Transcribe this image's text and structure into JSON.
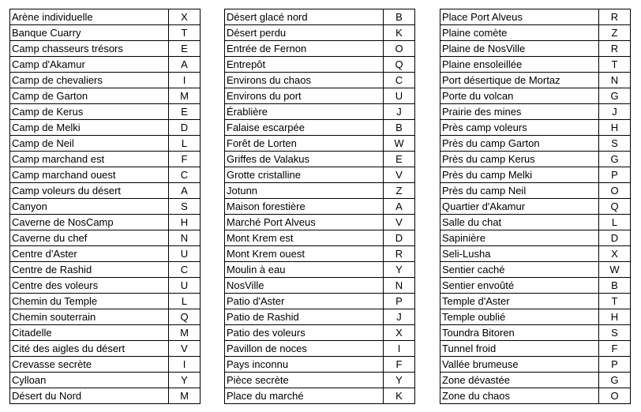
{
  "tables": [
    {
      "rows": [
        {
          "name": "Arène individuelle",
          "code": "X"
        },
        {
          "name": "Banque Cuarry",
          "code": "T"
        },
        {
          "name": "Camp chasseurs trésors",
          "code": "E"
        },
        {
          "name": "Camp d'Akamur",
          "code": "A"
        },
        {
          "name": "Camp de chevaliers",
          "code": "I"
        },
        {
          "name": "Camp de Garton",
          "code": "M"
        },
        {
          "name": "Camp de Kerus",
          "code": "E"
        },
        {
          "name": "Camp de Melki",
          "code": "D"
        },
        {
          "name": "Camp de Neil",
          "code": "L"
        },
        {
          "name": "Camp marchand est",
          "code": "F"
        },
        {
          "name": "Camp marchand ouest",
          "code": "C"
        },
        {
          "name": "Camp voleurs du désert",
          "code": "A"
        },
        {
          "name": "Canyon",
          "code": "S"
        },
        {
          "name": "Caverne de NosCamp",
          "code": "H"
        },
        {
          "name": "Caverne du chef",
          "code": "N"
        },
        {
          "name": "Centre d'Aster",
          "code": "U"
        },
        {
          "name": "Centre de Rashid",
          "code": "C"
        },
        {
          "name": "Centre des voleurs",
          "code": "U"
        },
        {
          "name": "Chemin du Temple",
          "code": "L"
        },
        {
          "name": "Chemin souterrain",
          "code": "Q"
        },
        {
          "name": "Citadelle",
          "code": "M"
        },
        {
          "name": "Cité des aigles du désert",
          "code": "V"
        },
        {
          "name": "Crevasse secrète",
          "code": "I"
        },
        {
          "name": "Cylloan",
          "code": "Y"
        },
        {
          "name": "Désert du Nord",
          "code": "M"
        }
      ]
    },
    {
      "rows": [
        {
          "name": "Désert glacé nord",
          "code": "B"
        },
        {
          "name": "Désert perdu",
          "code": "K"
        },
        {
          "name": "Entrée de Fernon",
          "code": "O"
        },
        {
          "name": "Entrepôt",
          "code": "Q"
        },
        {
          "name": "Environs du chaos",
          "code": "C"
        },
        {
          "name": "Environs du port",
          "code": "U"
        },
        {
          "name": "Érablière",
          "code": "J"
        },
        {
          "name": "Falaise escarpée",
          "code": "B"
        },
        {
          "name": "Forêt de Lorten",
          "code": "W"
        },
        {
          "name": "Griffes de Valakus",
          "code": "E"
        },
        {
          "name": "Grotte cristalline",
          "code": "V"
        },
        {
          "name": "Jotunn",
          "code": "Z"
        },
        {
          "name": "Maison forestière",
          "code": "A"
        },
        {
          "name": "Marché Port Alveus",
          "code": "V"
        },
        {
          "name": "Mont Krem est",
          "code": "D"
        },
        {
          "name": "Mont Krem ouest",
          "code": "R"
        },
        {
          "name": "Moulin à eau",
          "code": "Y"
        },
        {
          "name": "NosVille",
          "code": "N"
        },
        {
          "name": "Patio d'Aster",
          "code": "P"
        },
        {
          "name": "Patio de Rashid",
          "code": "J"
        },
        {
          "name": "Patio des voleurs",
          "code": "X"
        },
        {
          "name": "Pavillon de noces",
          "code": "I"
        },
        {
          "name": "Pays inconnu",
          "code": "F"
        },
        {
          "name": "Pièce secrète",
          "code": "Y"
        },
        {
          "name": "Place du marché",
          "code": "K"
        }
      ]
    },
    {
      "rows": [
        {
          "name": "Place Port Alveus",
          "code": "R"
        },
        {
          "name": "Plaine comète",
          "code": "Z"
        },
        {
          "name": "Plaine de NosVille",
          "code": "R"
        },
        {
          "name": "Plaine ensoleillée",
          "code": "T"
        },
        {
          "name": "Port désertique de Mortaz",
          "code": "N"
        },
        {
          "name": "Porte du volcan",
          "code": "G"
        },
        {
          "name": "Prairie des mines",
          "code": "J"
        },
        {
          "name": "Près camp voleurs",
          "code": "H"
        },
        {
          "name": "Près du camp Garton",
          "code": "S"
        },
        {
          "name": "Près du camp Kerus",
          "code": "G"
        },
        {
          "name": "Près du camp Melki",
          "code": "P"
        },
        {
          "name": "Près du camp Neil",
          "code": "O"
        },
        {
          "name": "Quartier d'Akamur",
          "code": "Q"
        },
        {
          "name": "Salle du chat",
          "code": "L"
        },
        {
          "name": "Sapinière",
          "code": "D"
        },
        {
          "name": "Seli-Lusha",
          "code": "X"
        },
        {
          "name": "Sentier caché",
          "code": "W"
        },
        {
          "name": "Sentier envoûté",
          "code": "B"
        },
        {
          "name": "Temple d'Aster",
          "code": "T"
        },
        {
          "name": "Temple oublié",
          "code": "H"
        },
        {
          "name": "Toundra Bitoren",
          "code": "S"
        },
        {
          "name": "Tunnel froid",
          "code": "F"
        },
        {
          "name": "Vallée brumeuse",
          "code": "P"
        },
        {
          "name": "Zone dévastée",
          "code": "G"
        },
        {
          "name": "Zone du chaos",
          "code": "O"
        }
      ]
    }
  ]
}
